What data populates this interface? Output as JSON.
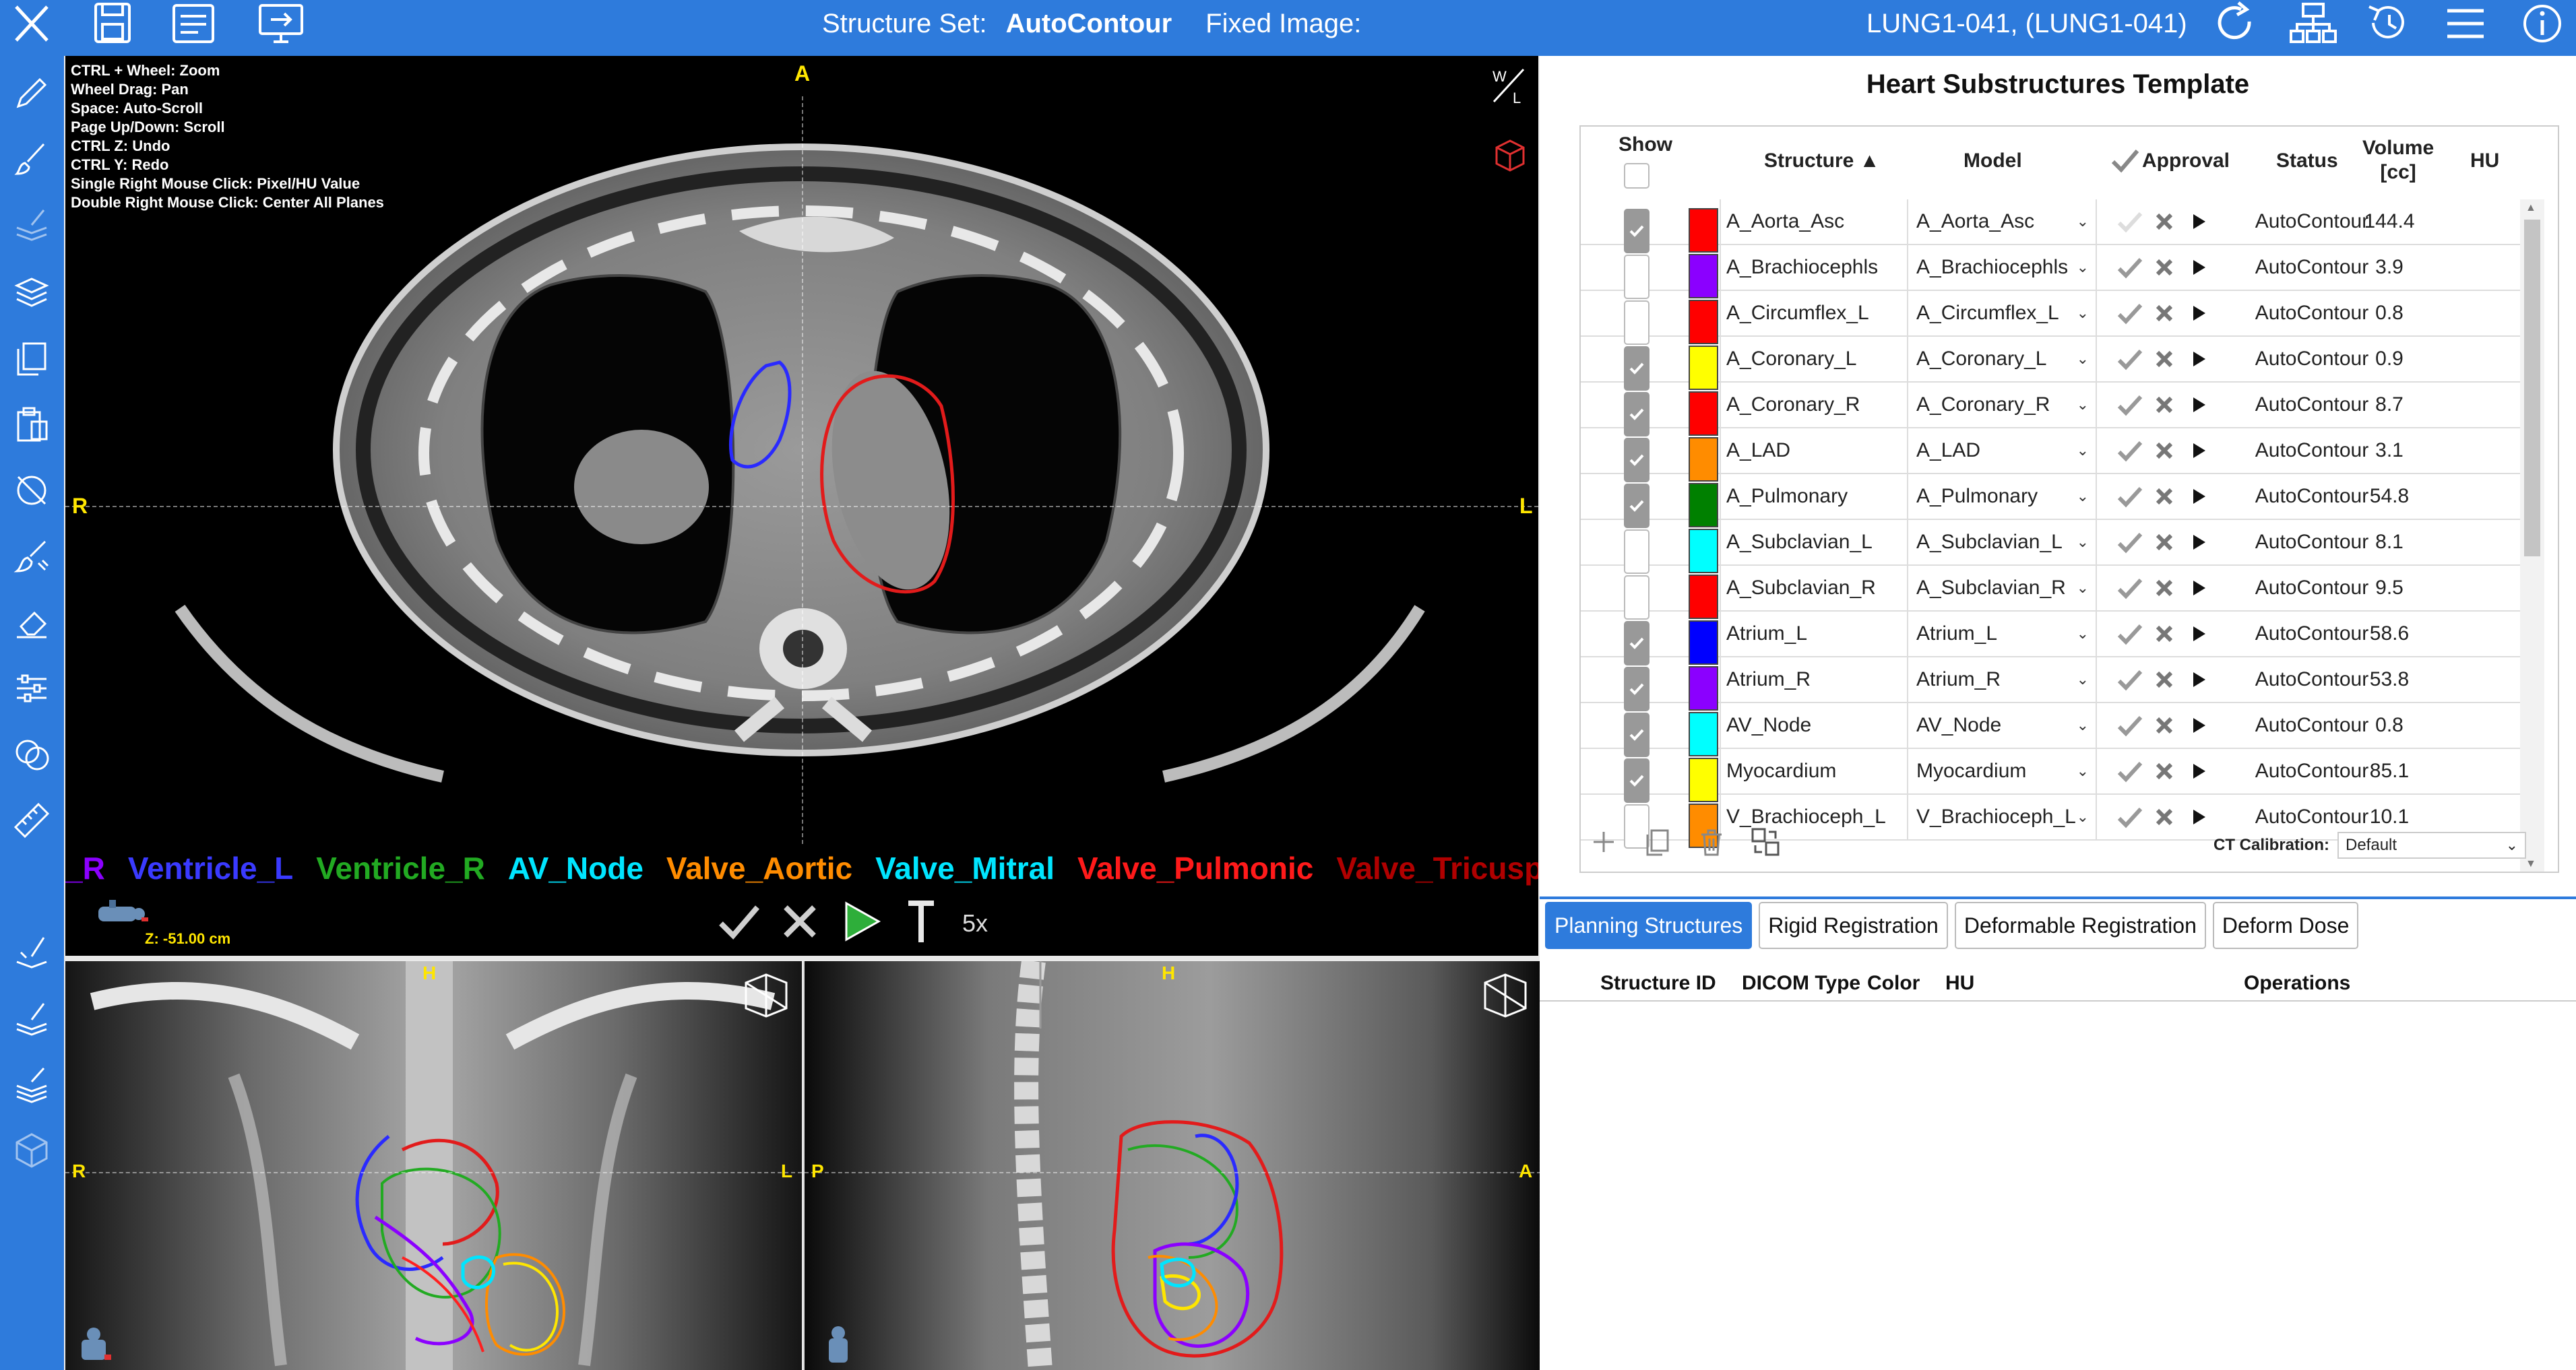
{
  "topbar": {
    "structure_set_label": "Structure Set:",
    "structure_set_value": "AutoContour",
    "fixed_image_label": "Fixed Image:",
    "patient": "LUNG1-041,  (LUNG1-041)"
  },
  "axial": {
    "help_text": "CTRL + Wheel: Zoom\nWheel Drag: Pan\nSpace: Auto-Scroll\nPage Up/Down: Scroll\nCTRL Z: Undo\nCTRL Y: Redo\nSingle Right Mouse Click: Pixel/HU Value\nDouble Right Mouse Click: Center All Planes",
    "orient_top": "A",
    "orient_left": "R",
    "orient_right": "L",
    "wl_label": "W/L",
    "z_position": "Z: -51.00 cm",
    "speed": "5x",
    "structure_labels": [
      {
        "text": "_R",
        "color": "#8b00ff"
      },
      {
        "text": "Ventricle_L",
        "color": "#3a3aff"
      },
      {
        "text": "Ventricle_R",
        "color": "#22aa22"
      },
      {
        "text": "AV_Node",
        "color": "#00e5ff"
      },
      {
        "text": "Valve_Aortic",
        "color": "#ff8c00"
      },
      {
        "text": "Valve_Mitral",
        "color": "#00e5ff"
      },
      {
        "text": "Valve_Pulmonic",
        "color": "#ff1a1a"
      },
      {
        "text": "Valve_Tricusp",
        "color": "#b00000"
      }
    ]
  },
  "coronal": {
    "orient_top": "H",
    "orient_left": "R",
    "orient_right": "L"
  },
  "sagittal": {
    "orient_top": "H",
    "orient_left": "P",
    "orient_right": "A"
  },
  "template": {
    "title": "Heart Substructures Template",
    "headers": {
      "show": "Show",
      "structure": "Structure ▲",
      "model": "Model",
      "approval": "Approval",
      "status": "Status",
      "volume": "Volume\n[cc]",
      "hu": "HU"
    },
    "rows": [
      {
        "name": "A_Aorta_Asc",
        "color": "#ff0000",
        "show": true,
        "model": "A_Aorta_Asc",
        "status": "AutoContour",
        "volume": "144.4"
      },
      {
        "name": "A_Brachiocephls",
        "color": "#8b00ff",
        "show": false,
        "model": "A_Brachiocephls",
        "status": "AutoContour",
        "volume": "3.9"
      },
      {
        "name": "A_Circumflex_L",
        "color": "#ff0000",
        "show": false,
        "model": "A_Circumflex_L",
        "status": "AutoContour",
        "volume": "0.8"
      },
      {
        "name": "A_Coronary_L",
        "color": "#ffff00",
        "show": true,
        "model": "A_Coronary_L",
        "status": "AutoContour",
        "volume": "0.9"
      },
      {
        "name": "A_Coronary_R",
        "color": "#ff0000",
        "show": true,
        "model": "A_Coronary_R",
        "status": "AutoContour",
        "volume": "8.7"
      },
      {
        "name": "A_LAD",
        "color": "#ff8c00",
        "show": true,
        "model": "A_LAD",
        "status": "AutoContour",
        "volume": "3.1"
      },
      {
        "name": "A_Pulmonary",
        "color": "#008000",
        "show": true,
        "model": "A_Pulmonary",
        "status": "AutoContour",
        "volume": "54.8"
      },
      {
        "name": "A_Subclavian_L",
        "color": "#00ffff",
        "show": false,
        "model": "A_Subclavian_L",
        "status": "AutoContour",
        "volume": "8.1"
      },
      {
        "name": "A_Subclavian_R",
        "color": "#ff0000",
        "show": false,
        "model": "A_Subclavian_R",
        "status": "AutoContour",
        "volume": "9.5"
      },
      {
        "name": "Atrium_L",
        "color": "#0000ff",
        "show": true,
        "model": "Atrium_L",
        "status": "AutoContour",
        "volume": "58.6"
      },
      {
        "name": "Atrium_R",
        "color": "#8b00ff",
        "show": true,
        "model": "Atrium_R",
        "status": "AutoContour",
        "volume": "53.8"
      },
      {
        "name": "AV_Node",
        "color": "#00ffff",
        "show": true,
        "model": "AV_Node",
        "status": "AutoContour",
        "volume": "0.8"
      },
      {
        "name": "Myocardium",
        "color": "#ffff00",
        "show": true,
        "model": "Myocardium",
        "status": "AutoContour",
        "volume": "85.1"
      },
      {
        "name": "V_Brachioceph_L",
        "color": "#ff8c00",
        "show": false,
        "model": "V_Brachioceph_L",
        "status": "AutoContour",
        "volume": "10.1"
      }
    ],
    "ct_calibration_label": "CT Calibration:",
    "ct_calibration_value": "Default"
  },
  "tabs": [
    {
      "label": "Planning Structures",
      "active": true
    },
    {
      "label": "Rigid Registration",
      "active": false
    },
    {
      "label": "Deformable Registration",
      "active": false
    },
    {
      "label": "Deform Dose",
      "active": false
    }
  ],
  "planning_table": {
    "headers": [
      "Structure ID",
      "DICOM Type",
      "Color",
      "HU",
      "Operations"
    ]
  },
  "colors": {
    "accent": "#2e7bdc"
  }
}
